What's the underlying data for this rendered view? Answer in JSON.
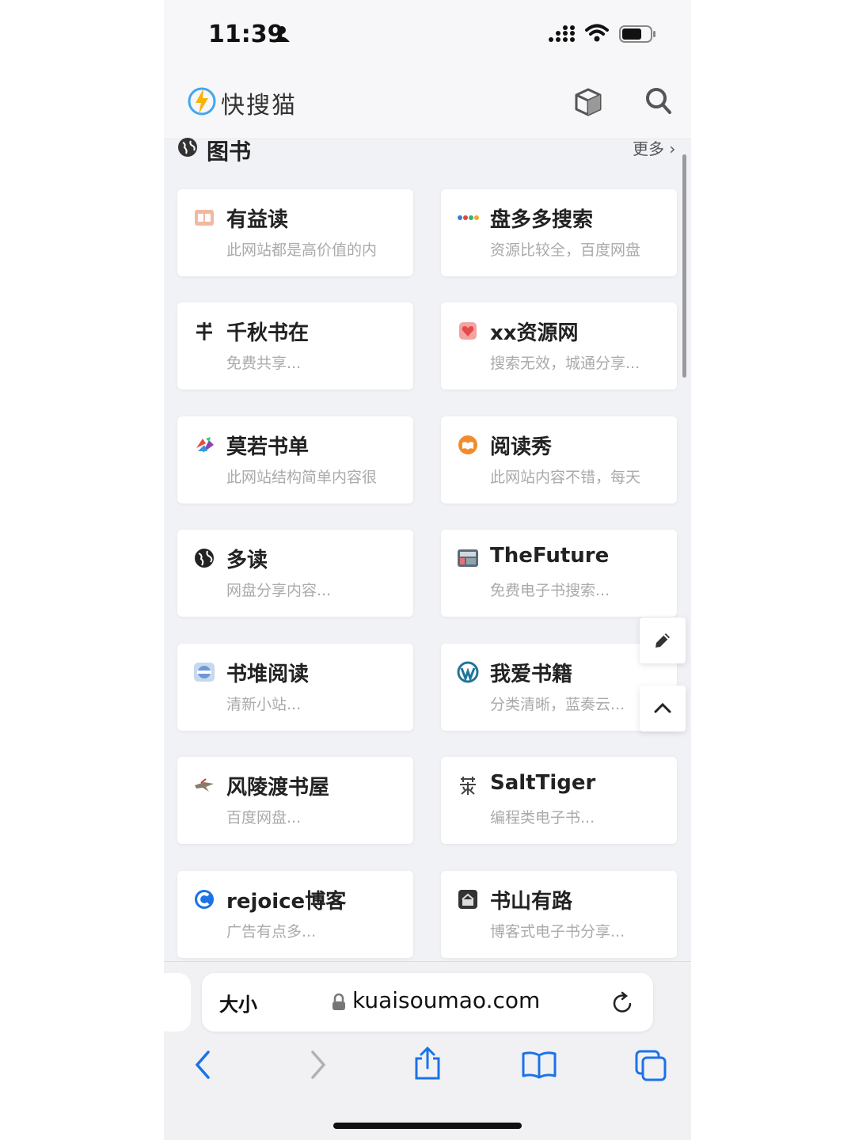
{
  "status_bar": {
    "time": "11:39"
  },
  "header": {
    "app_name": "快搜猫"
  },
  "section": {
    "title": "图书",
    "more": "更多 ›"
  },
  "cards": [
    {
      "title": "有益读",
      "desc": "此网站都是高价值的内",
      "icon": "book-card-icon"
    },
    {
      "title": "盘多多搜索",
      "desc": "资源比较全，百度网盘",
      "icon": "dots-logo-icon"
    },
    {
      "title": "千秋书在",
      "desc": "免费共享...",
      "icon": "shu-char-icon"
    },
    {
      "title": "xx资源网",
      "desc": "搜索无效，城通分享...",
      "icon": "heart-box-icon"
    },
    {
      "title": "莫若书单",
      "desc": "此网站结构简单内容很",
      "icon": "colorful-books-icon"
    },
    {
      "title": "阅读秀",
      "desc": "此网站内容不错，每天",
      "icon": "orange-book-icon"
    },
    {
      "title": "多读",
      "desc": "网盘分享内容...",
      "icon": "globe-icon"
    },
    {
      "title": "TheFuture",
      "desc": "免费电子书搜索...",
      "icon": "screen-thumbnail-icon"
    },
    {
      "title": "书堆阅读",
      "desc": "清新小站...",
      "icon": "www-icon"
    },
    {
      "title": "我爱书籍",
      "desc": "分类清晰，蓝奏云...",
      "icon": "wordpress-icon"
    },
    {
      "title": "风陵渡书屋",
      "desc": "百度网盘...",
      "icon": "bird-icon"
    },
    {
      "title": "SaltTiger",
      "desc": "编程类电子书...",
      "icon": "seal-char-icon"
    },
    {
      "title": "rejoice博客",
      "desc": "广告有点多...",
      "icon": "blue-c-icon"
    },
    {
      "title": "书山有路",
      "desc": "博客式电子书分享...",
      "icon": "dark-box-icon"
    }
  ],
  "address_bar": {
    "size_label": "大小",
    "url": "kuaisoumao.com"
  },
  "colors": {
    "background": "#f1f2f6",
    "card": "#ffffff",
    "accent": "#1a73e8"
  }
}
